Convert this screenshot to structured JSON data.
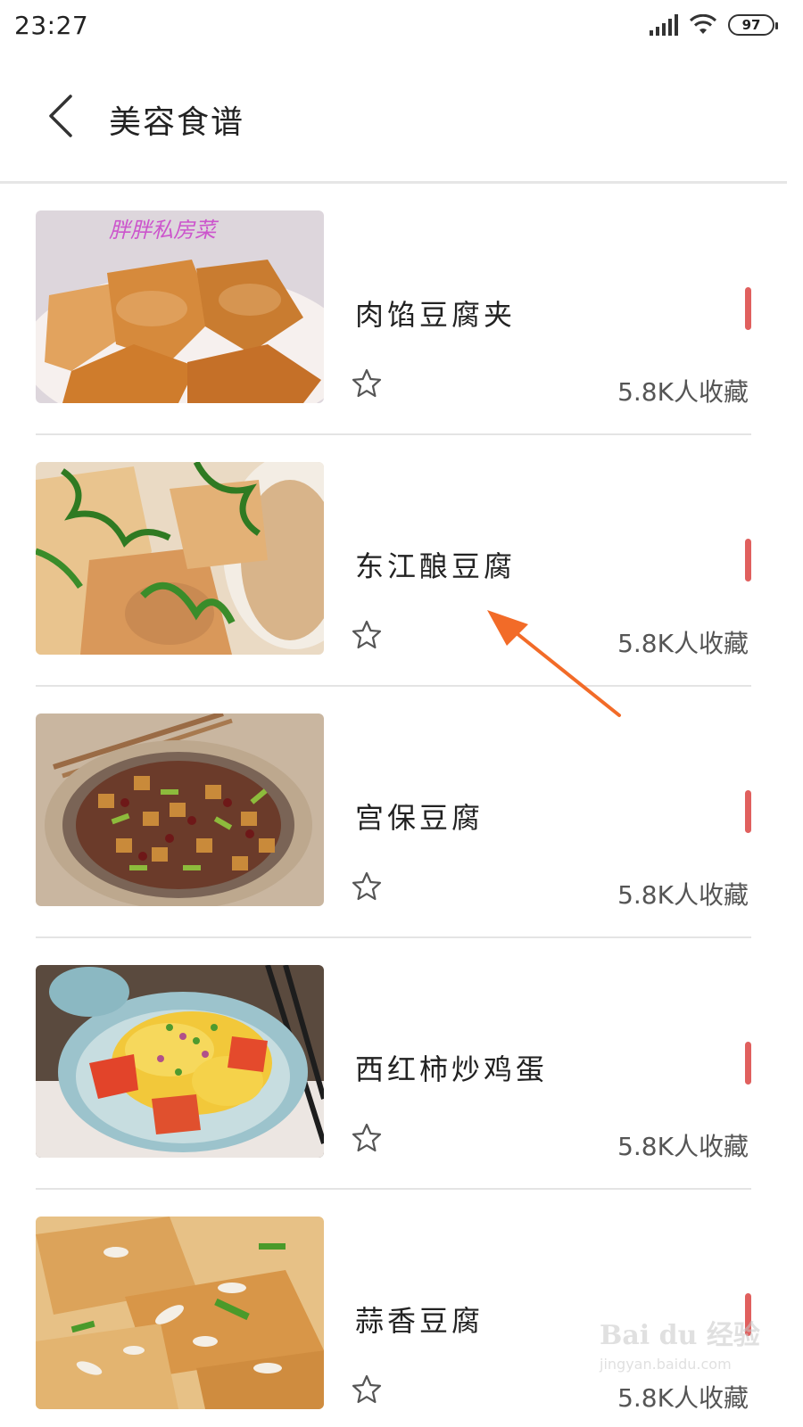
{
  "status_bar": {
    "time": "23:27",
    "battery": "97"
  },
  "header": {
    "title": "美容食谱"
  },
  "recipes": [
    {
      "name": "肉馅豆腐夹",
      "favorites": "5.8K人收藏",
      "image_caption": "胖胖私房菜"
    },
    {
      "name": "东江酿豆腐",
      "favorites": "5.8K人收藏"
    },
    {
      "name": "宫保豆腐",
      "favorites": "5.8K人收藏"
    },
    {
      "name": "西红柿炒鸡蛋",
      "favorites": "5.8K人收藏"
    },
    {
      "name": "蒜香豆腐",
      "favorites": "5.8K人收藏"
    }
  ],
  "watermark": {
    "logo": "Bai du 经验",
    "url": "jingyan.baidu.com"
  },
  "colors": {
    "accent": "#e0605e",
    "annotation_arrow": "#f26b28",
    "divider": "#e4e4e4"
  },
  "icons": [
    "back-arrow-icon",
    "star-outline-icon",
    "signal-icon",
    "wifi-icon",
    "battery-icon"
  ]
}
